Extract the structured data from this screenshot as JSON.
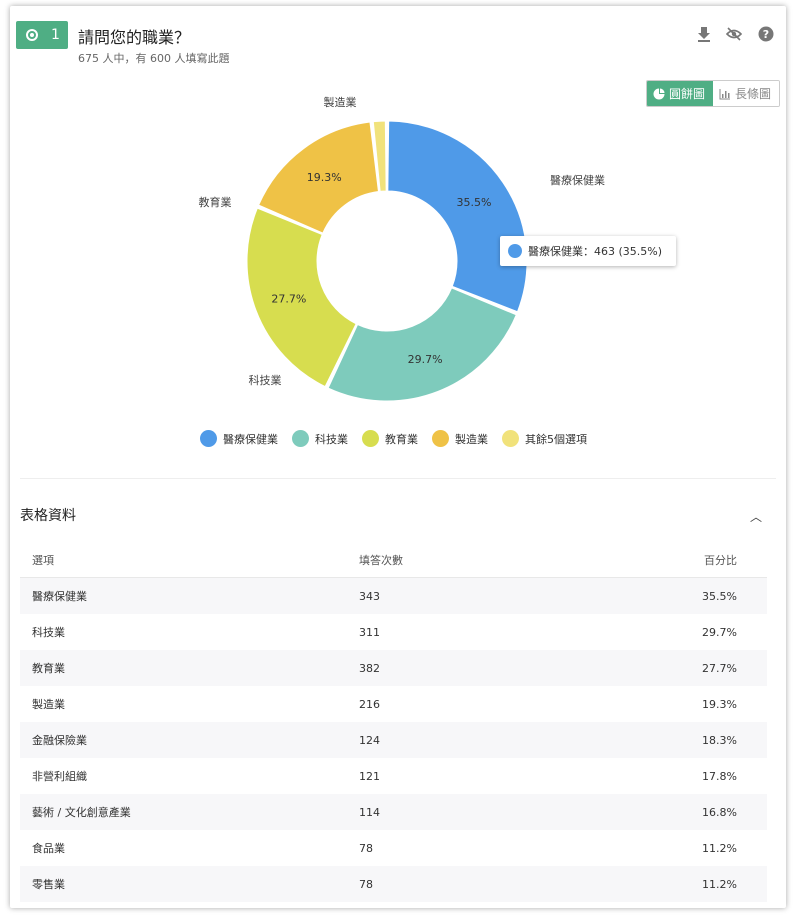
{
  "question": {
    "number": "1",
    "title": "請問您的職業？",
    "subtitle": "675 人中，有 600 人填寫此題"
  },
  "toolbar": {
    "download_icon": "download-icon",
    "hide_icon": "eye-off-icon",
    "help_icon": "help-icon"
  },
  "view_toggle": {
    "pie_label": "圓餅圖",
    "bar_label": "長條圖",
    "active": "pie"
  },
  "chart_data": {
    "type": "pie",
    "donut": true,
    "categories": [
      "醫療保健業",
      "科技業",
      "教育業",
      "製造業",
      "其餘5個選項"
    ],
    "values": [
      35.5,
      29.7,
      27.7,
      19.3,
      2.0
    ],
    "slice_percent_labels": [
      "35.5%",
      "29.7%",
      "27.7%",
      "19.3%",
      ""
    ],
    "colors": [
      "#4f9ae8",
      "#7ecbbc",
      "#d7dd4f",
      "#efc246",
      "#f1e27b"
    ],
    "legend_position": "bottom",
    "tooltip": "醫療保健業：463 (35.5%)"
  },
  "table": {
    "title": "表格資料",
    "headers": [
      "選項",
      "填答次數",
      "百分比"
    ],
    "rows": [
      [
        "醫療保健業",
        "343",
        "35.5%"
      ],
      [
        "科技業",
        "311",
        "29.7%"
      ],
      [
        "教育業",
        "382",
        "27.7%"
      ],
      [
        "製造業",
        "216",
        "19.3%"
      ],
      [
        "金融保險業",
        "124",
        "18.3%"
      ],
      [
        "非營利組織",
        "121",
        "17.8%"
      ],
      [
        "藝術 / 文化創意產業",
        "114",
        "16.8%"
      ],
      [
        "食品業",
        "78",
        "11.2%"
      ],
      [
        "零售業",
        "78",
        "11.2%"
      ]
    ]
  }
}
